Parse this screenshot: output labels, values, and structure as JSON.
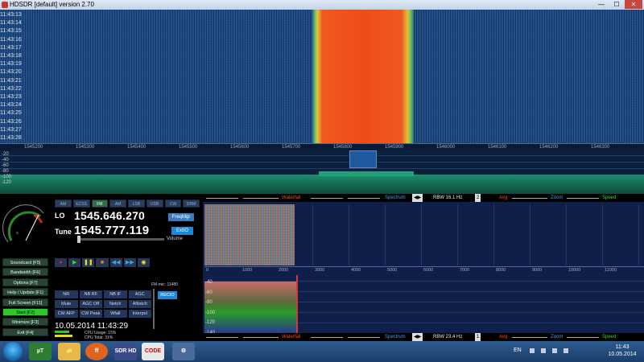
{
  "titlebar": {
    "title": "HDSDR [default] version 2.70",
    "min": "—",
    "max": "☐",
    "close": "✕"
  },
  "waterfall": {
    "time_labels": [
      "11:43:13",
      "11:43:14",
      "11:43:15",
      "11:43:16",
      "11:43:17",
      "11:43:18",
      "11:43:19",
      "11:43:20",
      "11:43:21",
      "11:43:22",
      "11:43:23",
      "11:43:24",
      "11:43:25",
      "11:43:26",
      "11:43:27",
      "11:43:28"
    ],
    "freq_labels": [
      "1545200",
      "1545300",
      "1545400",
      "1545500",
      "1545600",
      "1545700",
      "1545800",
      "1545900",
      "1546000",
      "1546100",
      "1546200",
      "1546300"
    ]
  },
  "strip": {
    "db_labels": [
      "-20",
      "-40",
      "-60",
      "-80",
      "-100",
      "-120"
    ]
  },
  "left": {
    "modes": [
      "AM",
      "ECSS",
      "FM",
      "AM",
      "LSB",
      "USB",
      "CW",
      "DRM"
    ],
    "active_mode_index": 2,
    "lo_label": "LO",
    "lo_value": "1545.646.270",
    "tune_label": "Tune",
    "tune_value": "1545.777.119",
    "freqmgr": "FreqMgr",
    "extio": "ExtIO",
    "volume": "Volume",
    "side_buttons": [
      "Soundcard [F5]",
      "Bandwidth [F6]",
      "Options [F7]",
      "Help / Update [F1]",
      "Full Screen [F11]",
      "Start [F2]",
      "Minimize [F3]",
      "Exit [F4]"
    ],
    "side_active_index": 5,
    "transport": [
      "●",
      "▶",
      "❚❚",
      "■",
      "◀◀",
      "▶▶",
      "◉"
    ],
    "dsp": [
      "NR",
      "NB RF",
      "NB IF",
      "AGC",
      "Mute",
      "AGC Off",
      "Notch",
      "ANotch",
      "CW AFP",
      "CW Peak",
      "Wfall",
      "Interpol"
    ],
    "fm_mic": "FM-mic: 11480",
    "extio2": "RECIO",
    "datetime": "10.05.2014 11:43:29",
    "cpu": [
      "CPU Usage: 15%",
      "CPU Total: 31%"
    ]
  },
  "right": {
    "row1": {
      "waterfall": "Waterfall",
      "spectrum": "Spectrum",
      "rbw": "RBW 16.1 Hz",
      "avg_val": "2",
      "avg": "Avg",
      "zoom": "Zoom",
      "speed": "Speed"
    },
    "row2": {
      "waterfall": "Waterfall",
      "spectrum": "Spectrum",
      "rbw": "RBW 23.4 Hz",
      "avg_val": "1",
      "avg": "Avg",
      "zoom": "Zoom",
      "speed": "Speed"
    },
    "axis_labels": [
      "0",
      "1000",
      "2000",
      "3000",
      "4000",
      "5000",
      "6000",
      "7000",
      "8000",
      "9000",
      "10000",
      "11000"
    ],
    "db_labels": [
      "-40",
      "-60",
      "-80",
      "-100",
      "-120",
      "-140"
    ]
  },
  "taskbar": {
    "torrent": "µT",
    "folder": "📁",
    "firefox": "ff",
    "sdr": "SDR HD",
    "code": "CODE",
    "tool": "⚙",
    "lang": "EN",
    "time": "11:43",
    "date": "10.05.2014"
  },
  "colors": {
    "signal": "#f04a1a",
    "accent": "#1f88d8",
    "start_green": "#2ec82e"
  }
}
